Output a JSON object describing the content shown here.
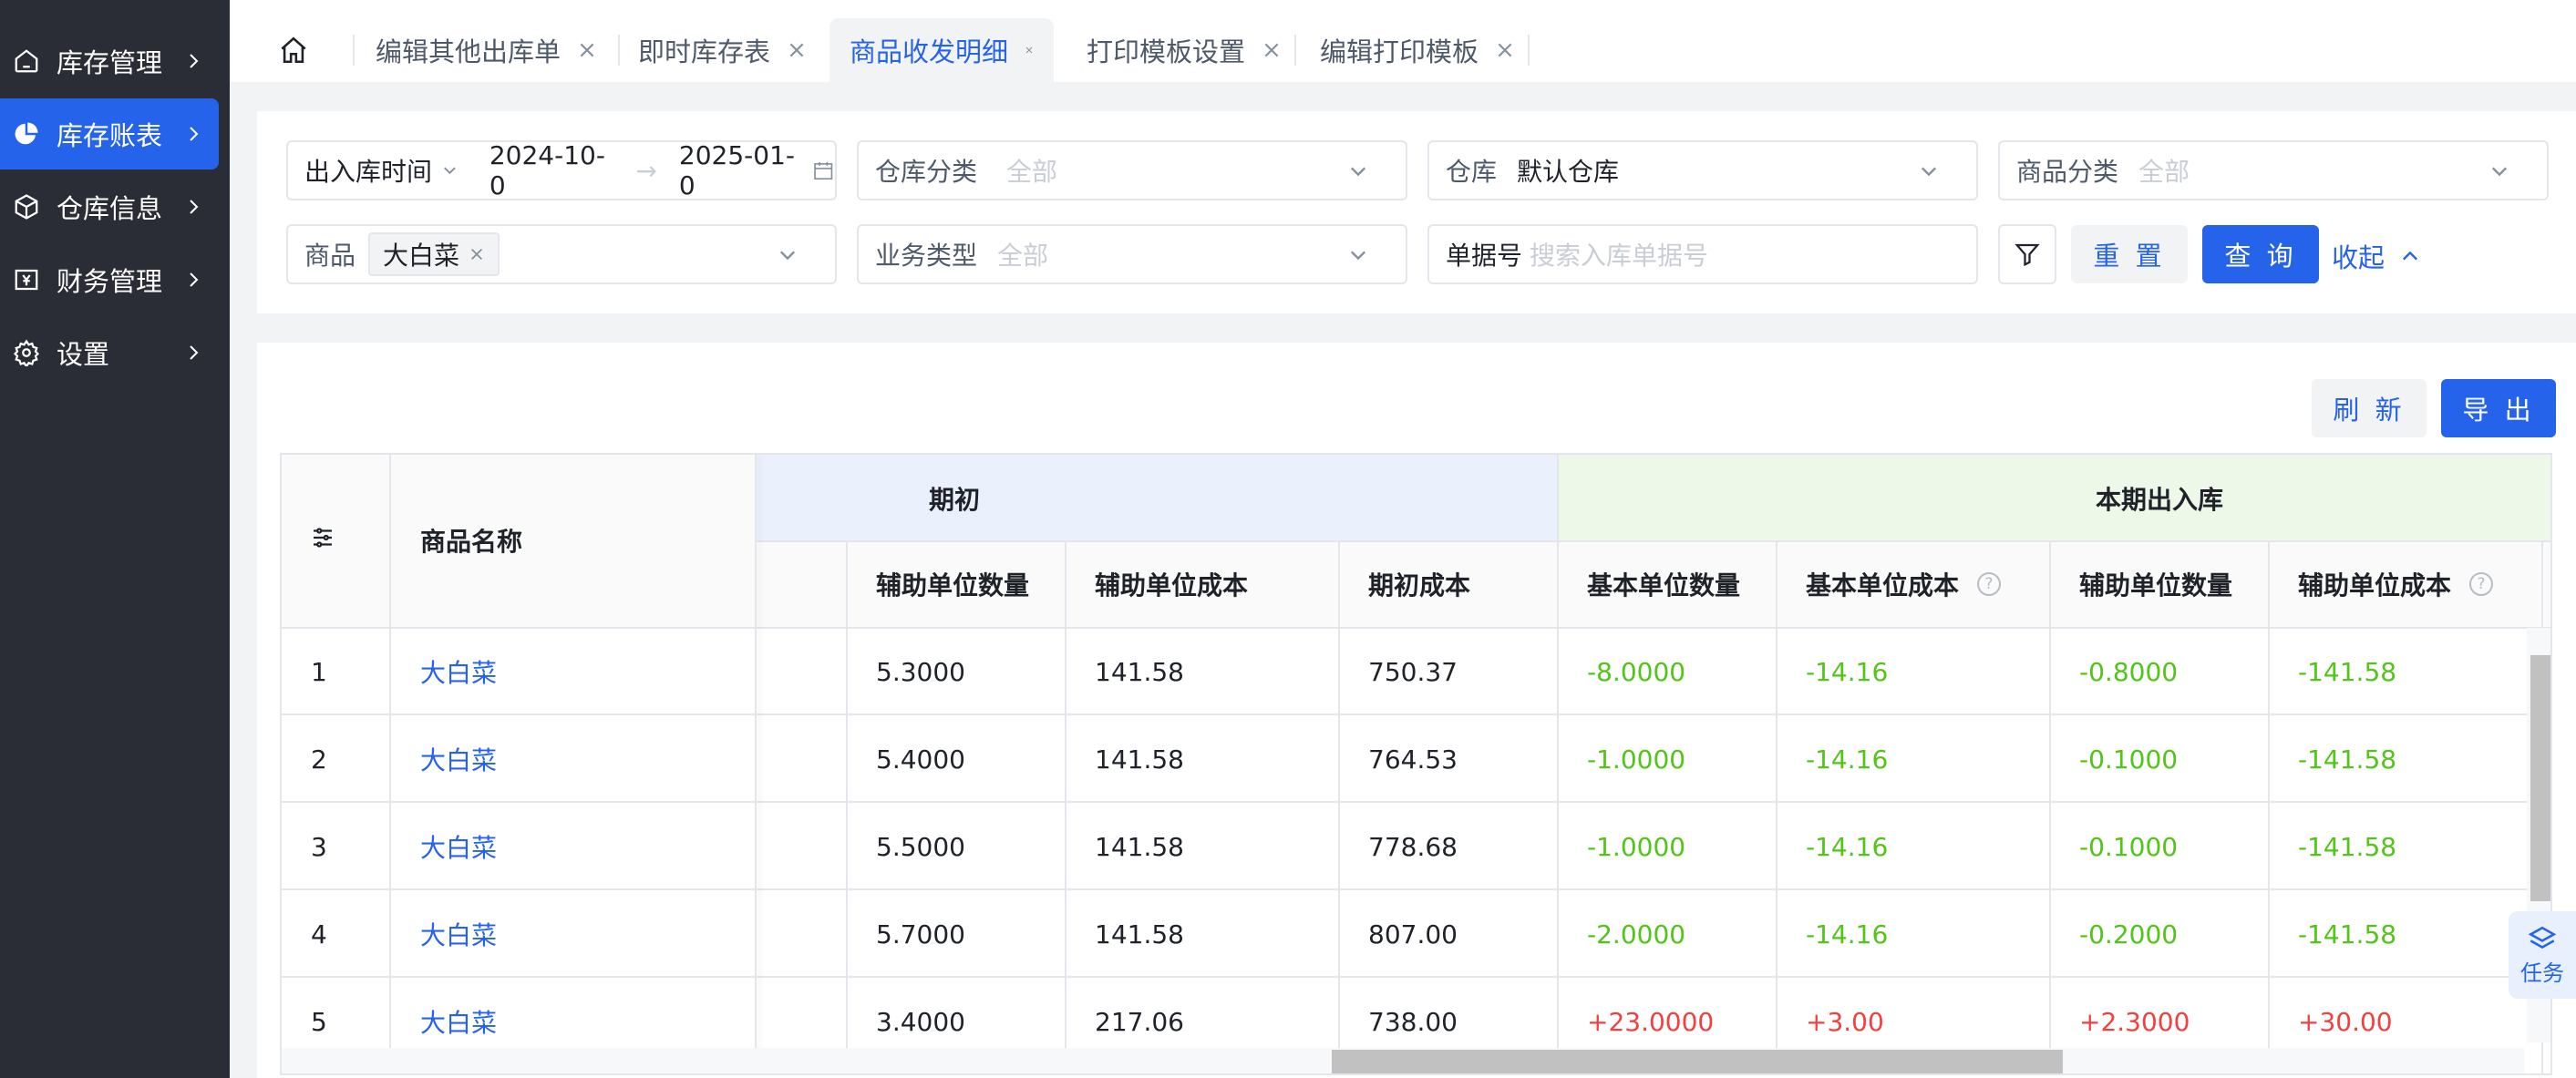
{
  "sidebar": {
    "items": [
      {
        "label": "库存管理",
        "icon": "home-icon"
      },
      {
        "label": "库存账表",
        "icon": "pie-chart-icon"
      },
      {
        "label": "仓库信息",
        "icon": "box-icon"
      },
      {
        "label": "财务管理",
        "icon": "yen-icon"
      },
      {
        "label": "设置",
        "icon": "gear-icon"
      }
    ],
    "active_index": 1
  },
  "tabs": [
    {
      "label": "编辑其他出库单"
    },
    {
      "label": "即时库存表"
    },
    {
      "label": "商品收发明细"
    },
    {
      "label": "打印模板设置"
    },
    {
      "label": "编辑打印模板"
    }
  ],
  "filters": {
    "date": {
      "label": "出入库时间",
      "start": "2024-10-0",
      "end": "2025-01-0"
    },
    "warehouse_category": {
      "label": "仓库分类",
      "placeholder": "全部"
    },
    "warehouse": {
      "label": "仓库",
      "value": "默认仓库"
    },
    "product_category": {
      "label": "商品分类",
      "placeholder": "全部"
    },
    "product": {
      "label": "商品",
      "tag": "大白菜"
    },
    "business_type": {
      "label": "业务类型",
      "placeholder": "全部"
    },
    "doc_no": {
      "label": "单据号",
      "placeholder": "搜索入库单据号"
    },
    "reset_label": "重 置",
    "query_label": "查 询",
    "collapse_label": "收起"
  },
  "toolbar": {
    "refresh_label": "刷 新",
    "export_label": "导 出"
  },
  "table": {
    "group_headers": {
      "opening": "期初",
      "outbound": "本期出入库"
    },
    "headers": {
      "name": "商品名称",
      "aux_qty": "辅助单位数量",
      "aux_cost": "辅助单位成本",
      "opening_cost": "期初成本",
      "base_qty": "基本单位数量",
      "base_cost": "基本单位成本",
      "out_aux_qty": "辅助单位数量",
      "out_aux_cost": "辅助单位成本"
    },
    "rows": [
      {
        "index": "1",
        "name": "大白菜",
        "aux_qty": "5.3000",
        "aux_cost": "141.58",
        "opening_cost": "750.37",
        "base_qty": "-8.0000",
        "base_cost": "-14.16",
        "out_aux_qty": "-0.8000",
        "out_aux_cost": "-141.58",
        "sign": "neg"
      },
      {
        "index": "2",
        "name": "大白菜",
        "aux_qty": "5.4000",
        "aux_cost": "141.58",
        "opening_cost": "764.53",
        "base_qty": "-1.0000",
        "base_cost": "-14.16",
        "out_aux_qty": "-0.1000",
        "out_aux_cost": "-141.58",
        "sign": "neg"
      },
      {
        "index": "3",
        "name": "大白菜",
        "aux_qty": "5.5000",
        "aux_cost": "141.58",
        "opening_cost": "778.68",
        "base_qty": "-1.0000",
        "base_cost": "-14.16",
        "out_aux_qty": "-0.1000",
        "out_aux_cost": "-141.58",
        "sign": "neg"
      },
      {
        "index": "4",
        "name": "大白菜",
        "aux_qty": "5.7000",
        "aux_cost": "141.58",
        "opening_cost": "807.00",
        "base_qty": "-2.0000",
        "base_cost": "-14.16",
        "out_aux_qty": "-0.2000",
        "out_aux_cost": "-141.58",
        "sign": "neg"
      },
      {
        "index": "5",
        "name": "大白菜",
        "aux_qty": "3.4000",
        "aux_cost": "217.06",
        "opening_cost": "738.00",
        "base_qty": "+23.0000",
        "base_cost": "+3.00",
        "out_aux_qty": "+2.3000",
        "out_aux_cost": "+30.00",
        "sign": "pos"
      }
    ]
  },
  "float_task_label": "任务",
  "colors": {
    "accent": "#2563eb",
    "negative": "#52c41a",
    "positive": "#f53f3f",
    "sidebar_bg": "#2b2d36"
  }
}
